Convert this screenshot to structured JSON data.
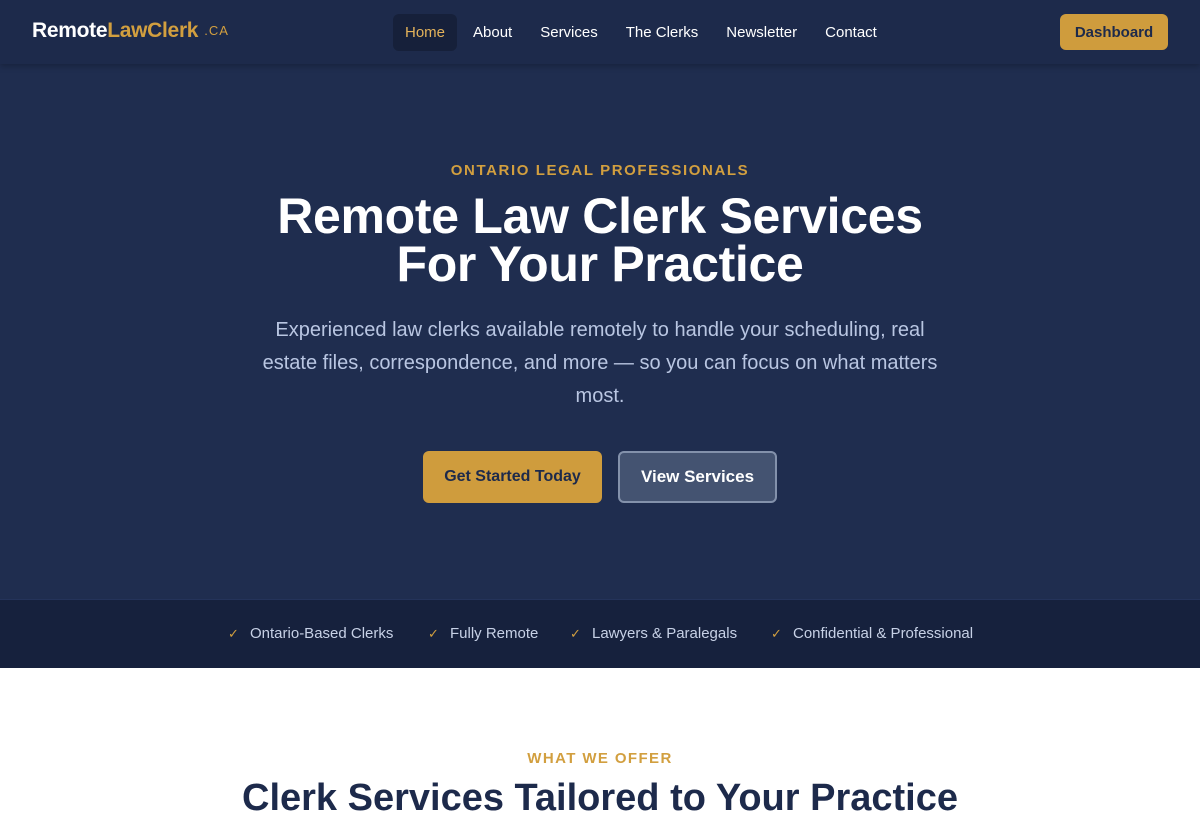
{
  "header": {
    "logo": {
      "part1": "Remote",
      "part2": "LawClerk",
      "tld": ".CA"
    },
    "nav": [
      {
        "label": "Home",
        "active": true
      },
      {
        "label": "About"
      },
      {
        "label": "Services"
      },
      {
        "label": "The Clerks"
      },
      {
        "label": "Newsletter"
      },
      {
        "label": "Contact"
      }
    ],
    "dashboard_label": "Dashboard"
  },
  "hero": {
    "eyebrow": "ONTARIO LEGAL PROFESSIONALS",
    "title_line1": "Remote Law Clerk Services",
    "title_line2": "For Your Practice",
    "description": "Experienced law clerks available remotely to handle your scheduling, real estate files, correspondence, and more — so you can focus on what matters most.",
    "primary_cta": "Get Started Today",
    "secondary_cta": "View Services"
  },
  "trust": {
    "items": [
      "Ontario-Based Clerks",
      "Fully Remote",
      "Lawyers & Paralegals",
      "Confidential & Professional"
    ]
  },
  "offer": {
    "eyebrow": "WHAT WE OFFER",
    "title": "Clerk Services Tailored to Your Practice"
  },
  "colors": {
    "navy": "#1d2a4b",
    "hero": "#1f2d4f",
    "gold": "#cf9c3d",
    "trust_bar": "#16213d"
  }
}
